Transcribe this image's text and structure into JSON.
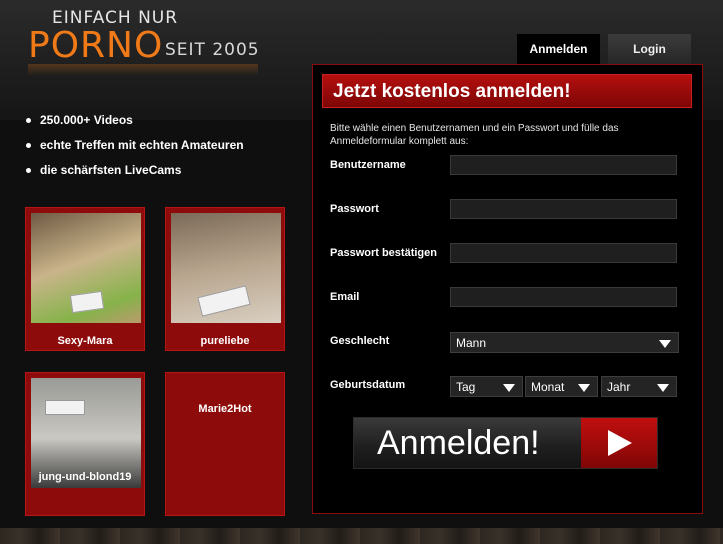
{
  "logo": {
    "line1": "EINFACH NUR",
    "big": "PORNO",
    "small": "SEIT 2005"
  },
  "features": [
    "250.000+ Videos",
    "echte Treffen mit echten Amateuren",
    "die schärfsten LiveCams"
  ],
  "profiles": [
    {
      "name": "Sexy-Mara"
    },
    {
      "name": "pureliebe"
    },
    {
      "name": "jung-und-blond19"
    },
    {
      "name": "Marie2Hot"
    }
  ],
  "tabs": {
    "register": "Anmelden",
    "login": "Login"
  },
  "form": {
    "title": "Jetzt kostenlos anmelden!",
    "intro": "Bitte wähle einen Benutzernamen und ein Passwort und fülle das Anmeldeformular komplett aus:",
    "labels": {
      "username": "Benutzername",
      "password": "Passwort",
      "password_confirm": "Passwort bestätigen",
      "email": "Email",
      "gender": "Geschlecht",
      "birthdate": "Geburtsdatum"
    },
    "gender_value": "Mann",
    "day_value": "Tag",
    "month_value": "Monat",
    "year_value": "Jahr",
    "submit": "Anmelden!"
  },
  "colors": {
    "accent": "#b50f0f",
    "logo_orange": "#f07a18",
    "panel_border": "#8e0b0b"
  }
}
